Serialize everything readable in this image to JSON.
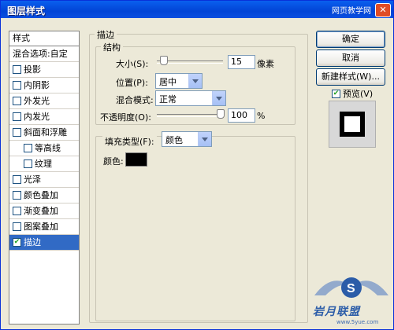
{
  "window": {
    "title": "图层样式",
    "watermark": "网页教学网",
    "close_label": "✕"
  },
  "left_panel": {
    "header": "样式",
    "items": [
      {
        "label": "混合选项:自定",
        "checkbox": false,
        "checked": false,
        "indent": false,
        "selected": false
      },
      {
        "label": "投影",
        "checkbox": true,
        "checked": false,
        "indent": false,
        "selected": false
      },
      {
        "label": "内阴影",
        "checkbox": true,
        "checked": false,
        "indent": false,
        "selected": false
      },
      {
        "label": "外发光",
        "checkbox": true,
        "checked": false,
        "indent": false,
        "selected": false
      },
      {
        "label": "内发光",
        "checkbox": true,
        "checked": false,
        "indent": false,
        "selected": false
      },
      {
        "label": "斜面和浮雕",
        "checkbox": true,
        "checked": false,
        "indent": false,
        "selected": false
      },
      {
        "label": "等高线",
        "checkbox": true,
        "checked": false,
        "indent": true,
        "selected": false
      },
      {
        "label": "纹理",
        "checkbox": true,
        "checked": false,
        "indent": true,
        "selected": false
      },
      {
        "label": "光泽",
        "checkbox": true,
        "checked": false,
        "indent": false,
        "selected": false
      },
      {
        "label": "颜色叠加",
        "checkbox": true,
        "checked": false,
        "indent": false,
        "selected": false
      },
      {
        "label": "渐变叠加",
        "checkbox": true,
        "checked": false,
        "indent": false,
        "selected": false
      },
      {
        "label": "图案叠加",
        "checkbox": true,
        "checked": false,
        "indent": false,
        "selected": false
      },
      {
        "label": "描边",
        "checkbox": true,
        "checked": true,
        "indent": false,
        "selected": true
      }
    ]
  },
  "stroke": {
    "section_title": "描边",
    "structure_title": "结构",
    "size_label": "大小(S):",
    "size_value": "15",
    "size_unit": "像素",
    "size_level": 0.05,
    "position_label": "位置(P):",
    "position_value": "居中",
    "blend_label": "混合模式:",
    "blend_value": "正常",
    "opacity_label": "不透明度(O):",
    "opacity_value": "100",
    "opacity_unit": "%",
    "opacity_level": 1.0,
    "fill_type_label": "填充类型(F):",
    "fill_type_value": "颜色",
    "color_label": "颜色:",
    "color_value": "#000000"
  },
  "buttons": {
    "ok": "确定",
    "cancel": "取消",
    "new_style": "新建样式(W)...",
    "preview_label": "预览(V)",
    "preview_checked": true
  },
  "logo": {
    "text": "岩月联盟",
    "url": "www.5yue.com"
  },
  "colors": {
    "selection": "#316AC5",
    "titlebar": "#0A5FEE",
    "checkmark": "#21A121"
  }
}
